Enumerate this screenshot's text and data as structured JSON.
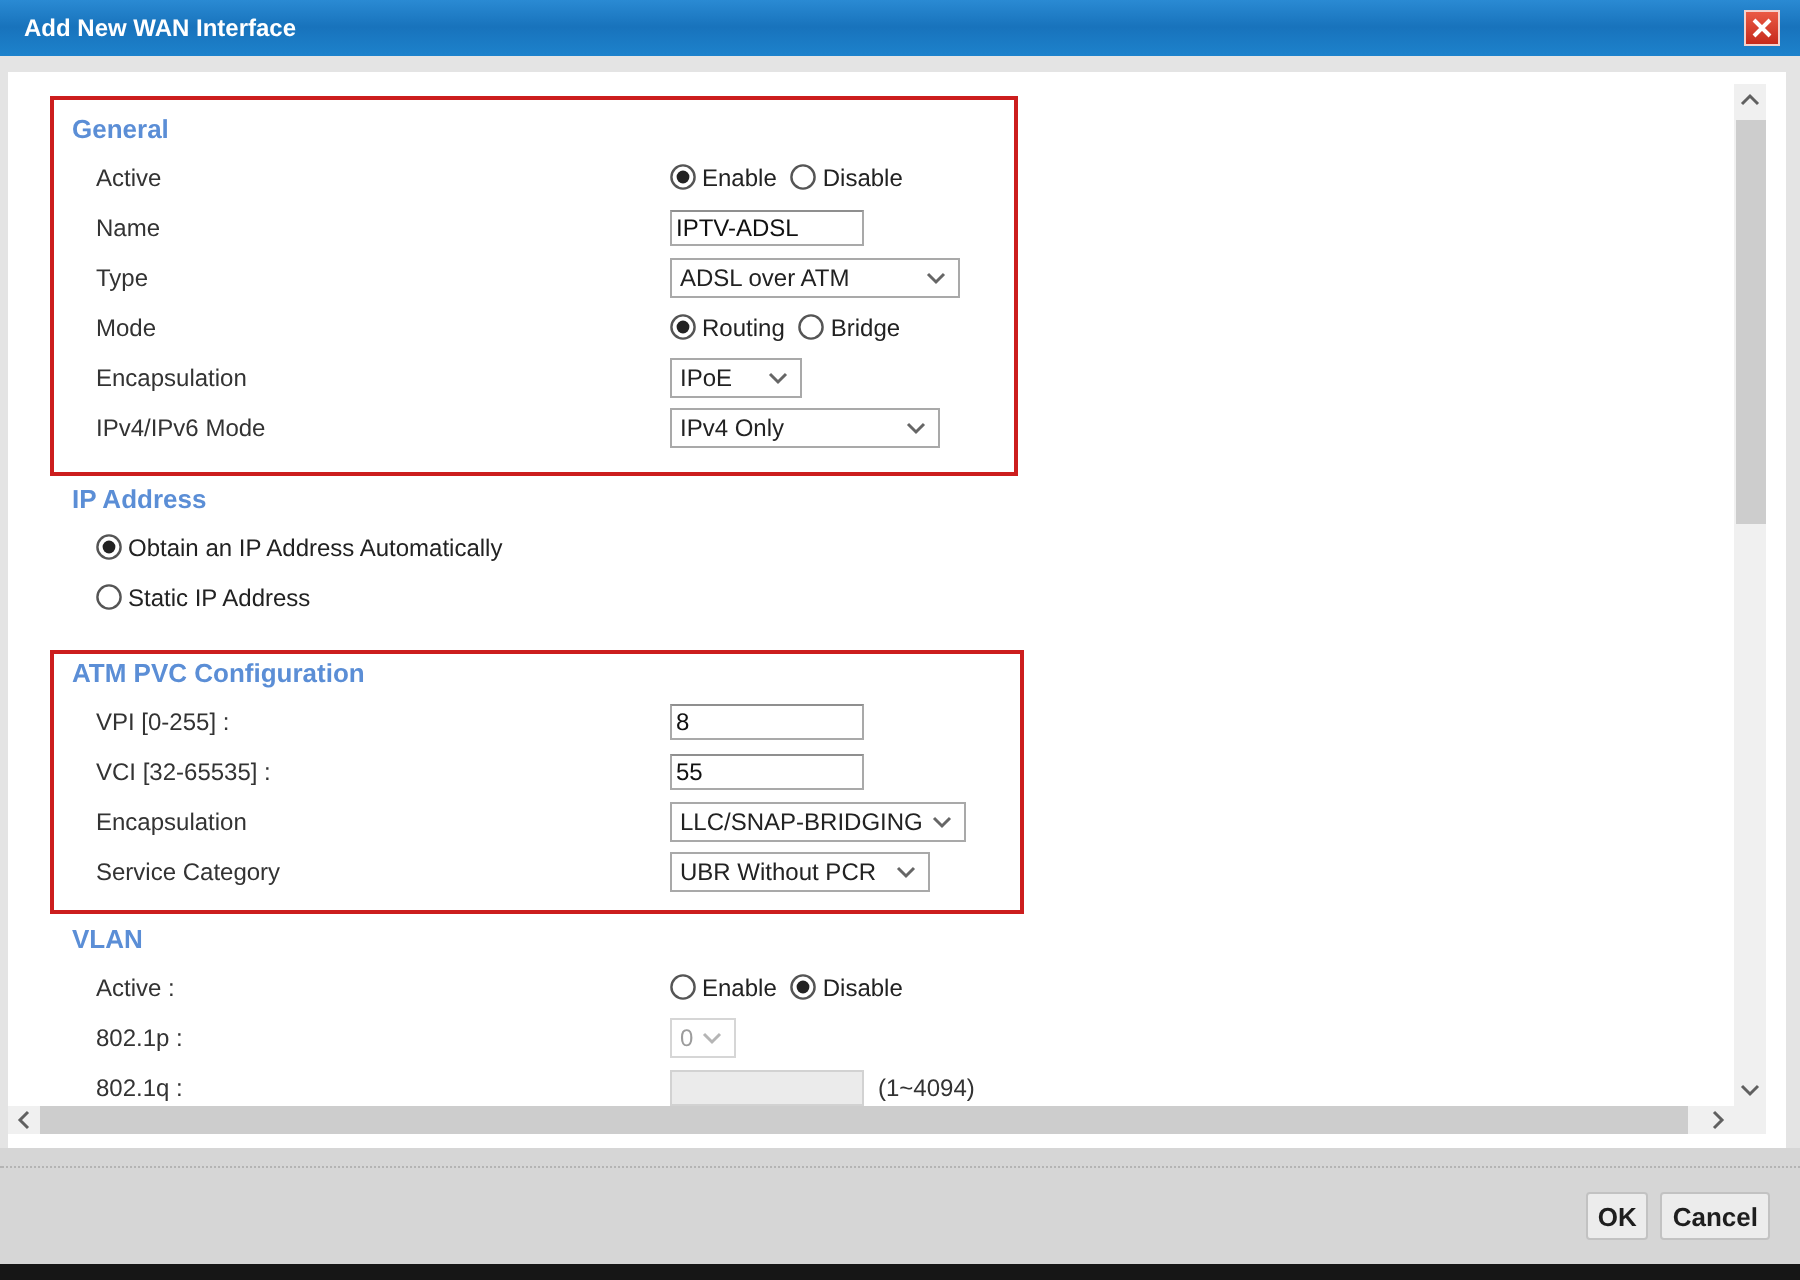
{
  "window": {
    "title": "Add New WAN Interface"
  },
  "sections": [
    {
      "title": "General",
      "highlighted": true,
      "rows": [
        {
          "kind": "radio",
          "label": "Active",
          "options": [
            {
              "label": "Enable",
              "selected": true
            },
            {
              "label": "Disable",
              "selected": false
            }
          ]
        },
        {
          "kind": "text",
          "label": "Name",
          "value": "IPTV-ADSL",
          "disabled": false
        },
        {
          "kind": "select",
          "label": "Type",
          "value": "ADSL over ATM",
          "disabled": false
        },
        {
          "kind": "radio",
          "label": "Mode",
          "options": [
            {
              "label": "Routing",
              "selected": true
            },
            {
              "label": "Bridge",
              "selected": false
            }
          ]
        },
        {
          "kind": "select",
          "label": "Encapsulation",
          "value": "IPoE",
          "disabled": false
        },
        {
          "kind": "select",
          "label": "IPv4/IPv6 Mode",
          "value": "IPv4 Only",
          "disabled": false
        }
      ]
    },
    {
      "title": "IP Address",
      "highlighted": false,
      "rows": [
        {
          "kind": "radio_list",
          "options": [
            {
              "label": "Obtain an IP Address Automatically",
              "selected": true
            },
            {
              "label": "Static IP Address",
              "selected": false
            }
          ]
        }
      ]
    },
    {
      "title": "ATM PVC Configuration",
      "highlighted": true,
      "rows": [
        {
          "kind": "text",
          "label": "VPI [0-255] :",
          "value": "8",
          "disabled": false
        },
        {
          "kind": "text",
          "label": "VCI [32-65535] :",
          "value": "55",
          "disabled": false
        },
        {
          "kind": "select",
          "label": "Encapsulation",
          "value": "LLC/SNAP-BRIDGING",
          "disabled": false
        },
        {
          "kind": "select",
          "label": "Service Category",
          "value": "UBR Without PCR",
          "disabled": false
        }
      ]
    },
    {
      "title": "VLAN",
      "highlighted": false,
      "rows": [
        {
          "kind": "radio",
          "label": "Active :",
          "options": [
            {
              "label": "Enable",
              "selected": false
            },
            {
              "label": "Disable",
              "selected": true
            }
          ]
        },
        {
          "kind": "select",
          "label": "802.1p :",
          "value": "0",
          "disabled": true
        },
        {
          "kind": "text",
          "label": "802.1q :",
          "disabled": true,
          "note": "(1~4094)"
        }
      ]
    }
  ],
  "buttons": [
    {
      "label": "OK"
    },
    {
      "label": "Cancel"
    }
  ]
}
